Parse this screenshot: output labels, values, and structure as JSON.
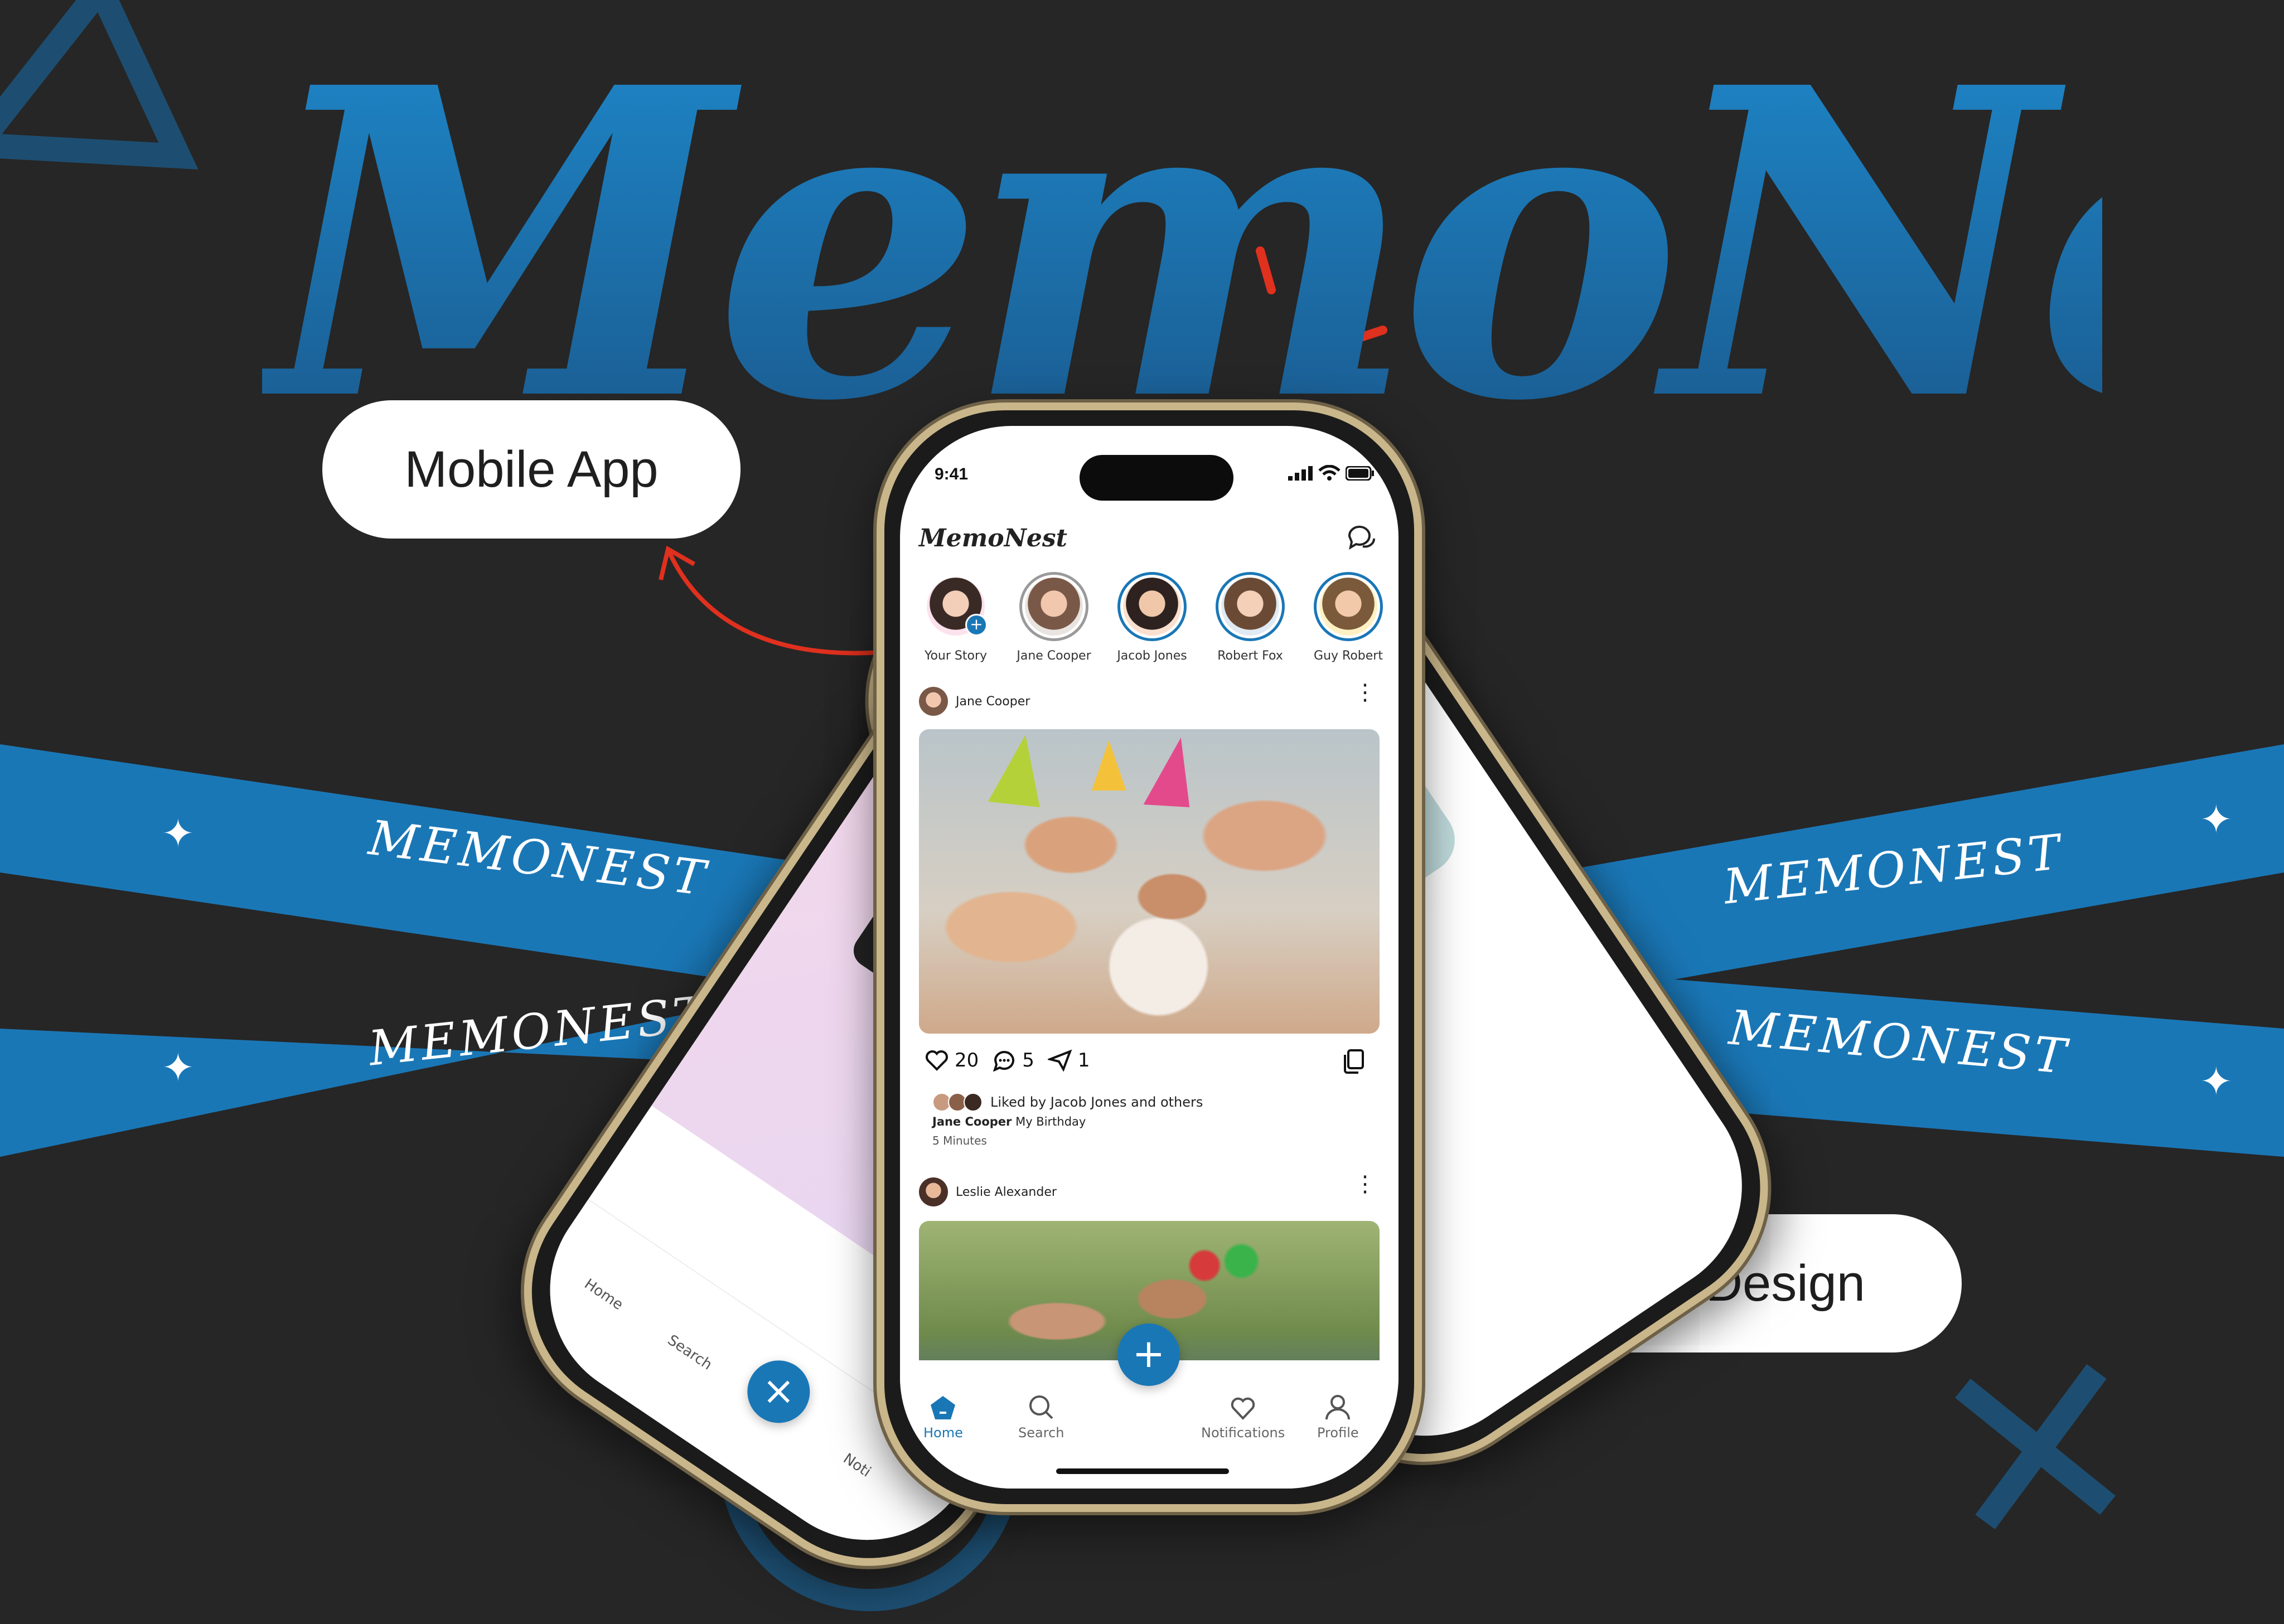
{
  "brand": {
    "hero_title": "MemoNest",
    "ribbon_word": "MEMONEST",
    "colors": {
      "accent": "#1a77b6",
      "background": "#262626",
      "highlight": "#e0301e",
      "frame": "#c9b68a"
    }
  },
  "pills": {
    "left": "Mobile App",
    "right": "UI Design"
  },
  "main_phone": {
    "status_time": "9:41",
    "app_logo": "MemoNest",
    "header_icon": "chat-bubbles-icon",
    "stories": [
      {
        "label": "Your Story",
        "own": true
      },
      {
        "label": "Jane Cooper"
      },
      {
        "label": "Jacob Jones"
      },
      {
        "label": "Robert Fox"
      },
      {
        "label": "Guy Robert"
      }
    ],
    "posts": [
      {
        "author": "Jane Cooper",
        "likes": "20",
        "comments": "5",
        "shares": "1",
        "liked_by": "Liked by Jacob Jones and others",
        "caption_author": "Jane Cooper",
        "caption_text": "My Birthday",
        "time_ago": "5 Minutes"
      },
      {
        "author": "Leslie Alexander"
      }
    ],
    "nav": [
      {
        "label": "Home",
        "icon": "home-pentagon-icon",
        "active": true
      },
      {
        "label": "Search",
        "icon": "search-icon"
      },
      {
        "label": "Notifications",
        "icon": "heart-icon"
      },
      {
        "label": "Profile",
        "icon": "profile-icon"
      }
    ],
    "fab_icon": "plus-icon"
  },
  "left_phone": {
    "nav": [
      {
        "label": "Home"
      },
      {
        "label": "Search"
      },
      {
        "label": "Noti"
      }
    ],
    "fab_icon": "close-icon"
  },
  "right_phone": {
    "header_icon": "settings-hexagon-icon"
  }
}
